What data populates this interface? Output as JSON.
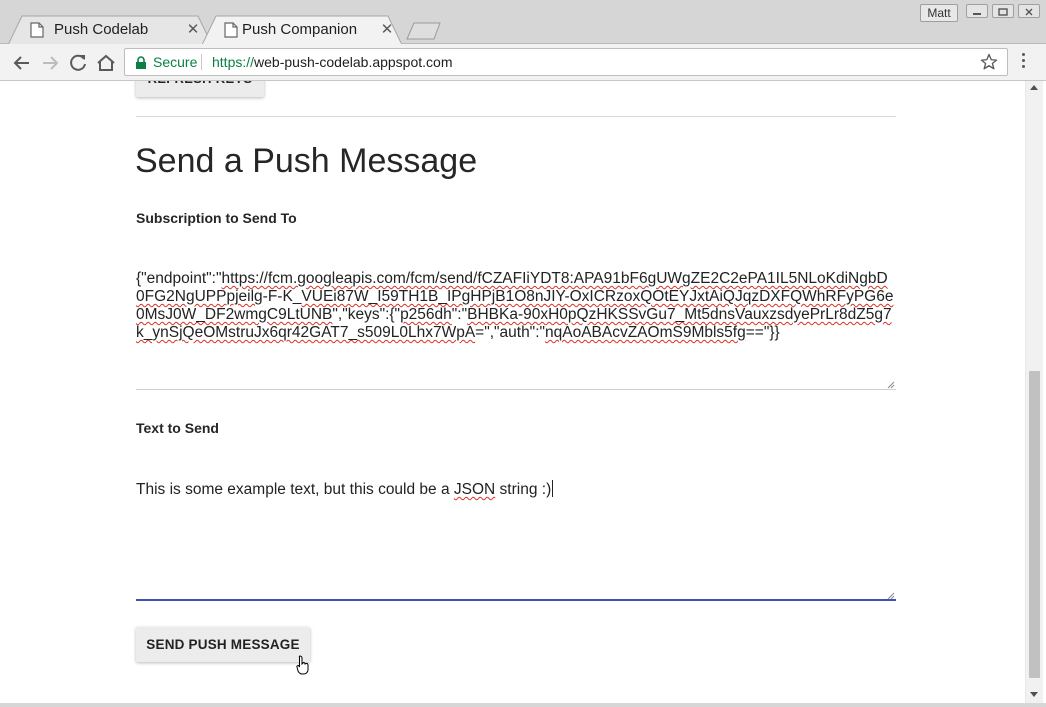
{
  "browser": {
    "tabs": [
      {
        "title": "Push Codelab",
        "active": false
      },
      {
        "title": "Push Companion",
        "active": true
      }
    ],
    "profile_name": "Matt",
    "address_bar": {
      "security_label": "Secure",
      "url_scheme": "https://",
      "url_host": "web-push-codelab.appspot.com"
    }
  },
  "page": {
    "refresh_button_label": "REFRESH KEYS",
    "section_title": "Send a Push Message",
    "subscription_label": "Subscription to Send To",
    "subscription_value": [
      {
        "t": "{\"endpoint\":\"",
        "u": false
      },
      {
        "t": "https://fcm.googleapis.com/fcm/send/fCZAFIiYDT8:APA91bF6gUWgZE2C2ePA1IL5NLoKdiNgbD0FG2NgUPPpjeilg",
        "u": true
      },
      {
        "t": "-F-K_",
        "u": false
      },
      {
        "t": "VUEi87W_I59TH1B_IPgHPjB1O8nJIY-OxICRzoxQOtEYJxtAiQJqzDXFQWhRFyPG6e0MsJ0W_DF2wmgC9LtUNB",
        "u": true
      },
      {
        "t": "\",\"keys\":{\"",
        "u": false
      },
      {
        "t": "p256dh",
        "u": true
      },
      {
        "t": "\":\"",
        "u": false
      },
      {
        "t": "BHBKa-90xH0pQzHKSSvGu7_Mt5dnsVauxzsdyePrLr8dZ5g7k_ynSjQeOMstruJx6qr42GAT7_s509L0Lhx7WpA",
        "u": true
      },
      {
        "t": "=\",\"auth\":\"",
        "u": false
      },
      {
        "t": "nqAoABAcvZAOmS9Mbls5fg",
        "u": true
      },
      {
        "t": "==\"}}",
        "u": false
      }
    ],
    "text_label": "Text to Send",
    "text_value": {
      "before": "This is some example text, but this could be a ",
      "underlined": "JSON",
      "after": " string :)"
    },
    "send_button_label": "SEND PUSH MESSAGE"
  },
  "icons": {
    "tab_icon": "page-icon",
    "back": "back-arrow-icon",
    "forward": "forward-arrow-icon",
    "reload": "reload-icon",
    "home": "home-icon",
    "lock": "lock-icon",
    "bookmark": "star-icon",
    "menu": "kebab-menu-icon",
    "cursor": "mouse-pointer-icon"
  },
  "colors": {
    "secure_green": "#0b8043",
    "focus_blue": "#3f51b5",
    "spellcheck_red": "#d93025"
  }
}
